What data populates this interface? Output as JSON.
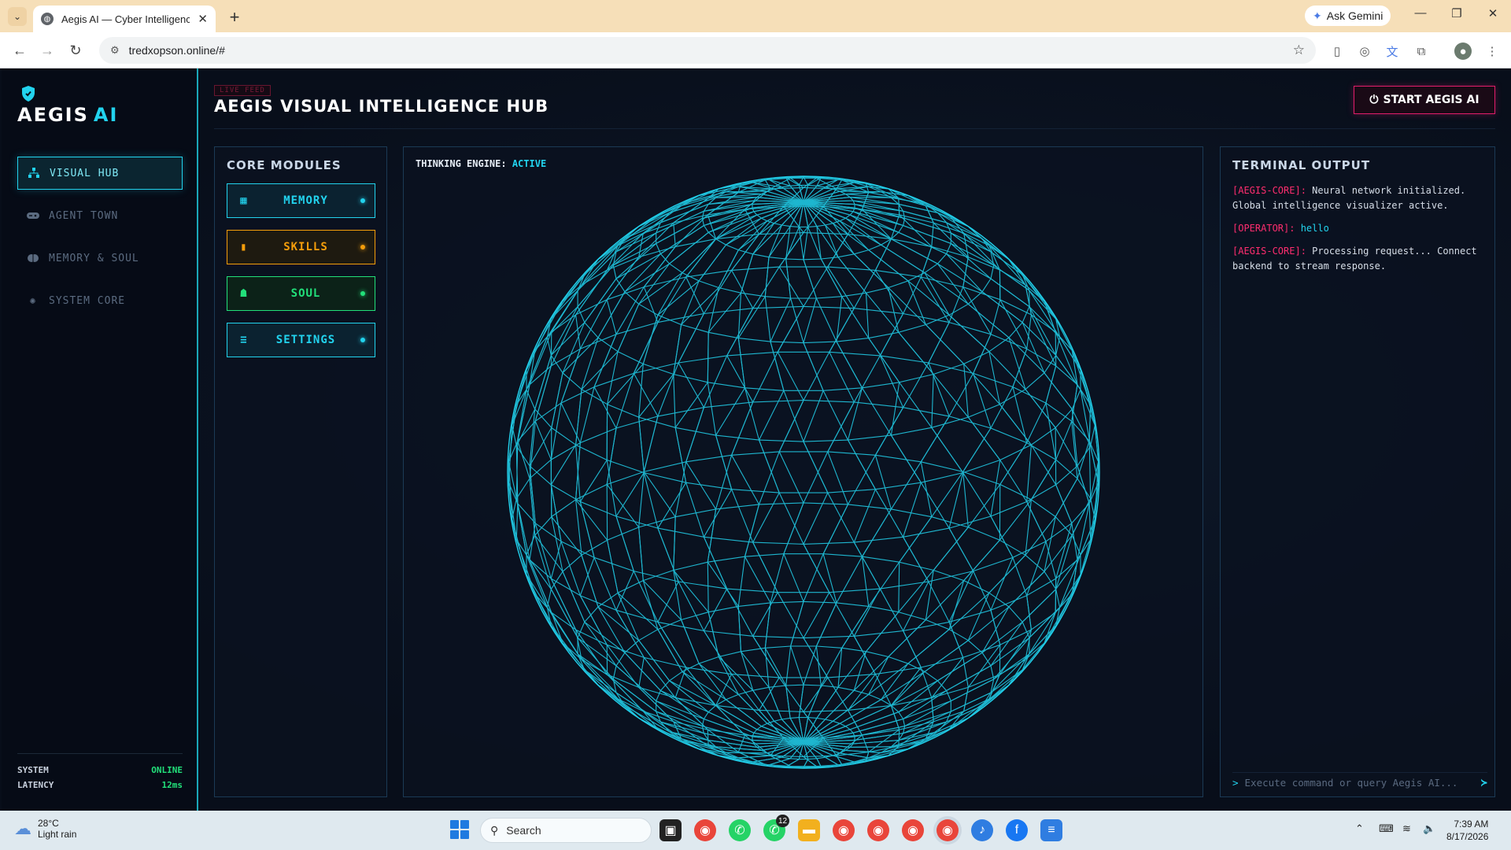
{
  "browser": {
    "tab_title": "Aegis AI — Cyber Intelligence &",
    "url": "tredxopson.online/#",
    "gemini_label": "Ask Gemini"
  },
  "app": {
    "brand_name": "AEGIS",
    "brand_suffix": "AI",
    "live_badge": "LIVE FEED",
    "hub_title": "AEGIS VISUAL INTELLIGENCE HUB",
    "start_label": "START AEGIS AI",
    "nav": [
      {
        "label": "VISUAL HUB",
        "icon": "sitemap-icon",
        "active": true
      },
      {
        "label": "AGENT TOWN",
        "icon": "gamepad-icon",
        "active": false
      },
      {
        "label": "MEMORY & SOUL",
        "icon": "brain-icon",
        "active": false
      },
      {
        "label": "SYSTEM CORE",
        "icon": "gear-icon",
        "active": false
      }
    ],
    "status": [
      {
        "key": "SYSTEM",
        "value": "ONLINE"
      },
      {
        "key": "LATENCY",
        "value": "12ms"
      }
    ],
    "core_modules": {
      "title": "CORE MODULES",
      "items": [
        {
          "label": "MEMORY",
          "icon": "chip-icon",
          "color": "#22d3ee",
          "bg": "#0b2230"
        },
        {
          "label": "SKILLS",
          "icon": "book-icon",
          "color": "#f59e0b",
          "bg": "#1e1a10"
        },
        {
          "label": "SOUL",
          "icon": "ghost-icon",
          "color": "#22e07a",
          "bg": "#0c2218"
        },
        {
          "label": "SETTINGS",
          "icon": "sliders-icon",
          "color": "#22d3ee",
          "bg": "#0b2230"
        }
      ]
    },
    "engine": {
      "label": "THINKING ENGINE:",
      "status": "ACTIVE"
    },
    "terminal": {
      "title": "TERMINAL OUTPUT",
      "lines": [
        {
          "tag": "[AEGIS-CORE]:",
          "text": " Neural network initialized. Global intelligence visualizer active."
        },
        {
          "tag": "[OPERATOR]:",
          "text": " hello"
        },
        {
          "tag": "[AEGIS-CORE]:",
          "text": " Processing request... Connect backend to stream response."
        }
      ],
      "prompt": ">",
      "placeholder": "Execute command or query Aegis AI..."
    },
    "accent": "#22d3ee",
    "alert": "#e11d6a"
  },
  "taskbar": {
    "temperature": "28°C",
    "weather": "Light rain",
    "search_label": "Search",
    "time": "7:39 AM",
    "date": "8/17/2026",
    "whatsapp_badge": "12"
  }
}
